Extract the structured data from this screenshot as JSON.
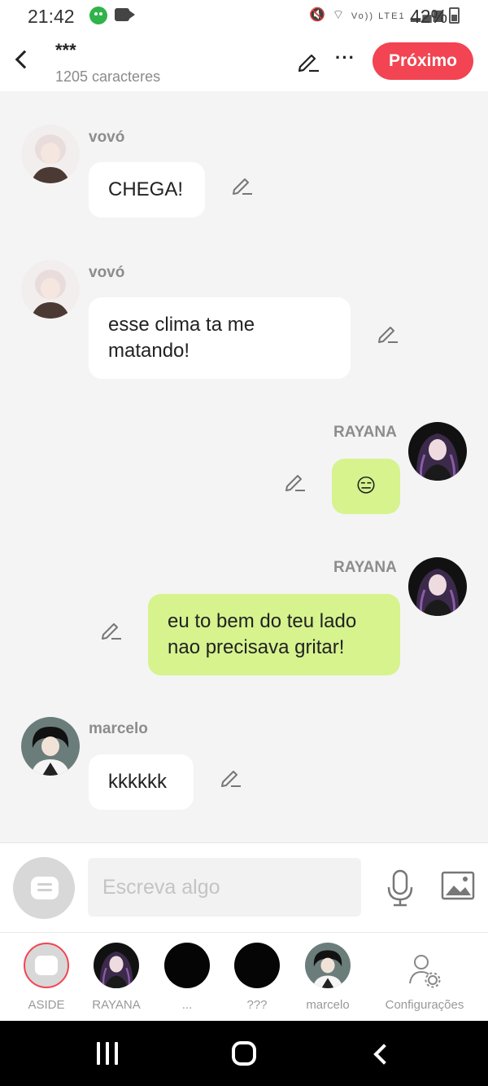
{
  "status_bar": {
    "time": "21:42",
    "network_text": "Vo)) LTE1",
    "battery": "42%",
    "icons": [
      "app-notification-icon",
      "video-camera-icon",
      "mute-icon",
      "wifi-icon",
      "signal-icon",
      "battery-icon"
    ]
  },
  "header": {
    "title": "***",
    "subtitle": "1205 caracteres",
    "more_label": "···",
    "next_label": "Próximo"
  },
  "messages": [
    {
      "speaker": "vovó",
      "text": "CHEGA!",
      "side": "left"
    },
    {
      "speaker": "vovó",
      "text": "esse clima ta me matando!",
      "side": "left"
    },
    {
      "speaker": "RAYANA",
      "text": "😑",
      "side": "right"
    },
    {
      "speaker": "RAYANA",
      "text": "eu to bem do teu lado nao precisava gritar!",
      "side": "right"
    },
    {
      "speaker": "marcelo",
      "text": "kkkkkk",
      "side": "left"
    }
  ],
  "composer": {
    "placeholder": "Escreva algo"
  },
  "characters": [
    {
      "label": "ASIDE"
    },
    {
      "label": "RAYANA"
    },
    {
      "label": "..."
    },
    {
      "label": "???"
    },
    {
      "label": "marcelo"
    }
  ],
  "settings_label": "Configurações",
  "colors": {
    "accent": "#f24452",
    "bubble_right": "#d6f38e",
    "bubble_left": "#ffffff",
    "background": "#f4f4f4"
  }
}
